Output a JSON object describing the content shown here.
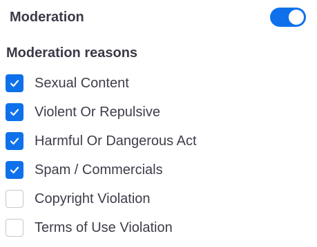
{
  "moderation": {
    "title": "Moderation",
    "enabled": true
  },
  "reasons": {
    "title": "Moderation reasons",
    "items": [
      {
        "label": "Sexual Content",
        "checked": true
      },
      {
        "label": "Violent Or Repulsive",
        "checked": true
      },
      {
        "label": "Harmful Or Dangerous Act",
        "checked": true
      },
      {
        "label": "Spam / Commercials",
        "checked": true
      },
      {
        "label": "Copyright Violation",
        "checked": false
      },
      {
        "label": "Terms of Use Violation",
        "checked": false
      }
    ]
  },
  "colors": {
    "accent": "#0e71eb",
    "text": "#3d3d4a",
    "unchecked_border": "#c7c7cf"
  }
}
